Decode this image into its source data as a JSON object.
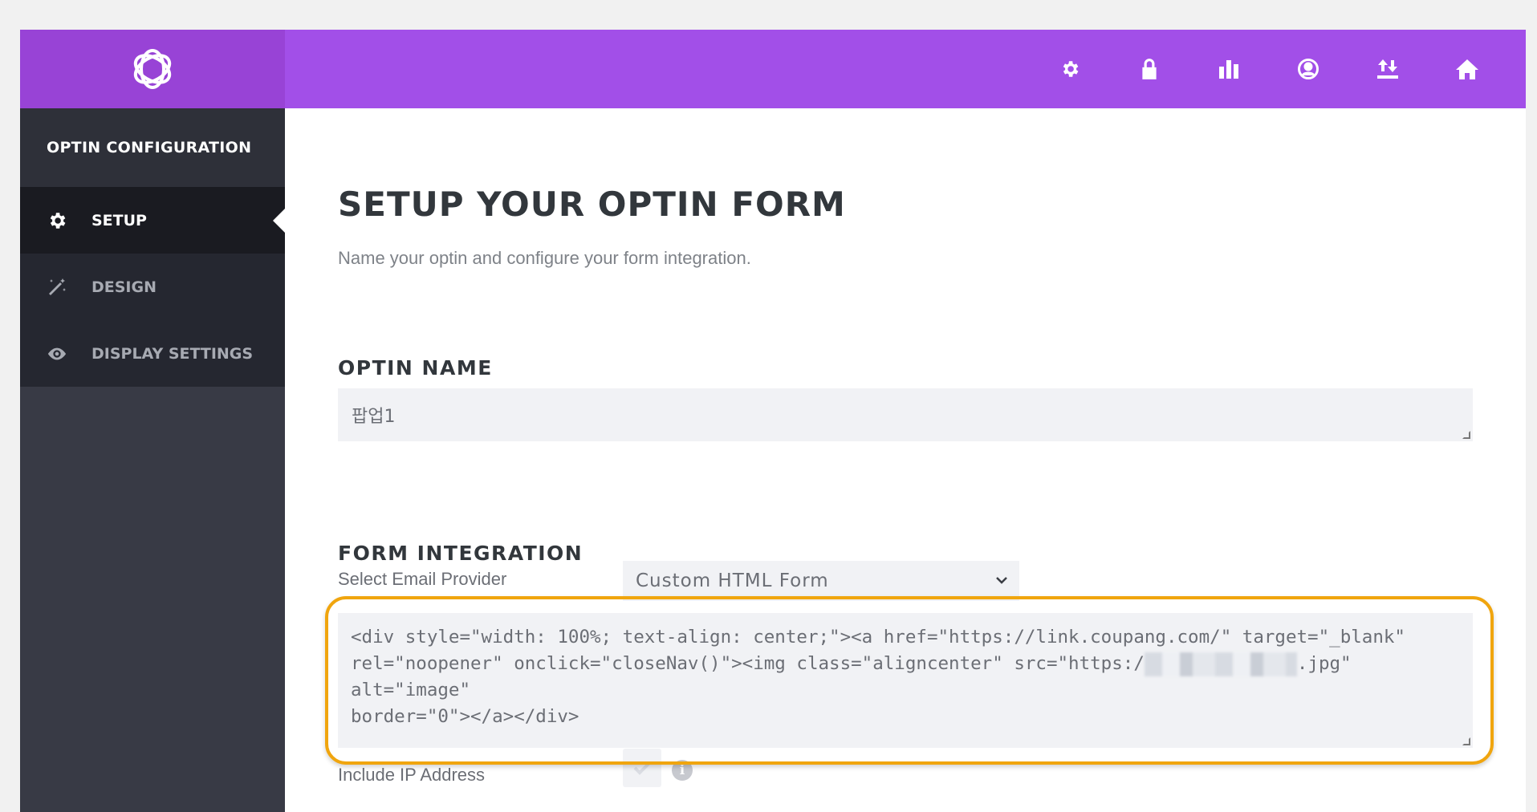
{
  "header": {
    "logo": "bloom-logo-icon",
    "icons": [
      "gear-icon",
      "lock-icon",
      "bar-chart-icon",
      "user-circle-icon",
      "import-export-icon",
      "home-icon"
    ]
  },
  "sidebar": {
    "title": "OPTIN CONFIGURATION",
    "items": [
      {
        "label": "SETUP",
        "icon": "gear-icon",
        "active": true
      },
      {
        "label": "DESIGN",
        "icon": "magic-wand-icon",
        "active": false
      },
      {
        "label": "DISPLAY SETTINGS",
        "icon": "eye-icon",
        "active": false
      }
    ]
  },
  "main": {
    "title": "SETUP YOUR OPTIN FORM",
    "subtitle": "Name your optin and configure your form integration.",
    "optin_name": {
      "heading": "OPTIN NAME",
      "value": "팝업1"
    },
    "form_integration": {
      "heading": "FORM INTEGRATION",
      "provider_label": "Select Email Provider",
      "provider_value": "Custom HTML Form",
      "code_part1": "<div style=\"width: 100%; text-align: center;\"><a href=\"https://link.coupang.com/\" target=\"_blank\"\nrel=\"noopener\" onclick=\"closeNav()\"><img class=\"aligncenter\" src=\"https:/",
      "code_part2": ".jpg\" alt=\"image\"\nborder=\"0\"></a></div>",
      "ip_label": "Include IP Address"
    }
  },
  "colors": {
    "topbar": "#a24fe8",
    "sidebar": "#383a45",
    "highlight": "#f0a50e"
  }
}
